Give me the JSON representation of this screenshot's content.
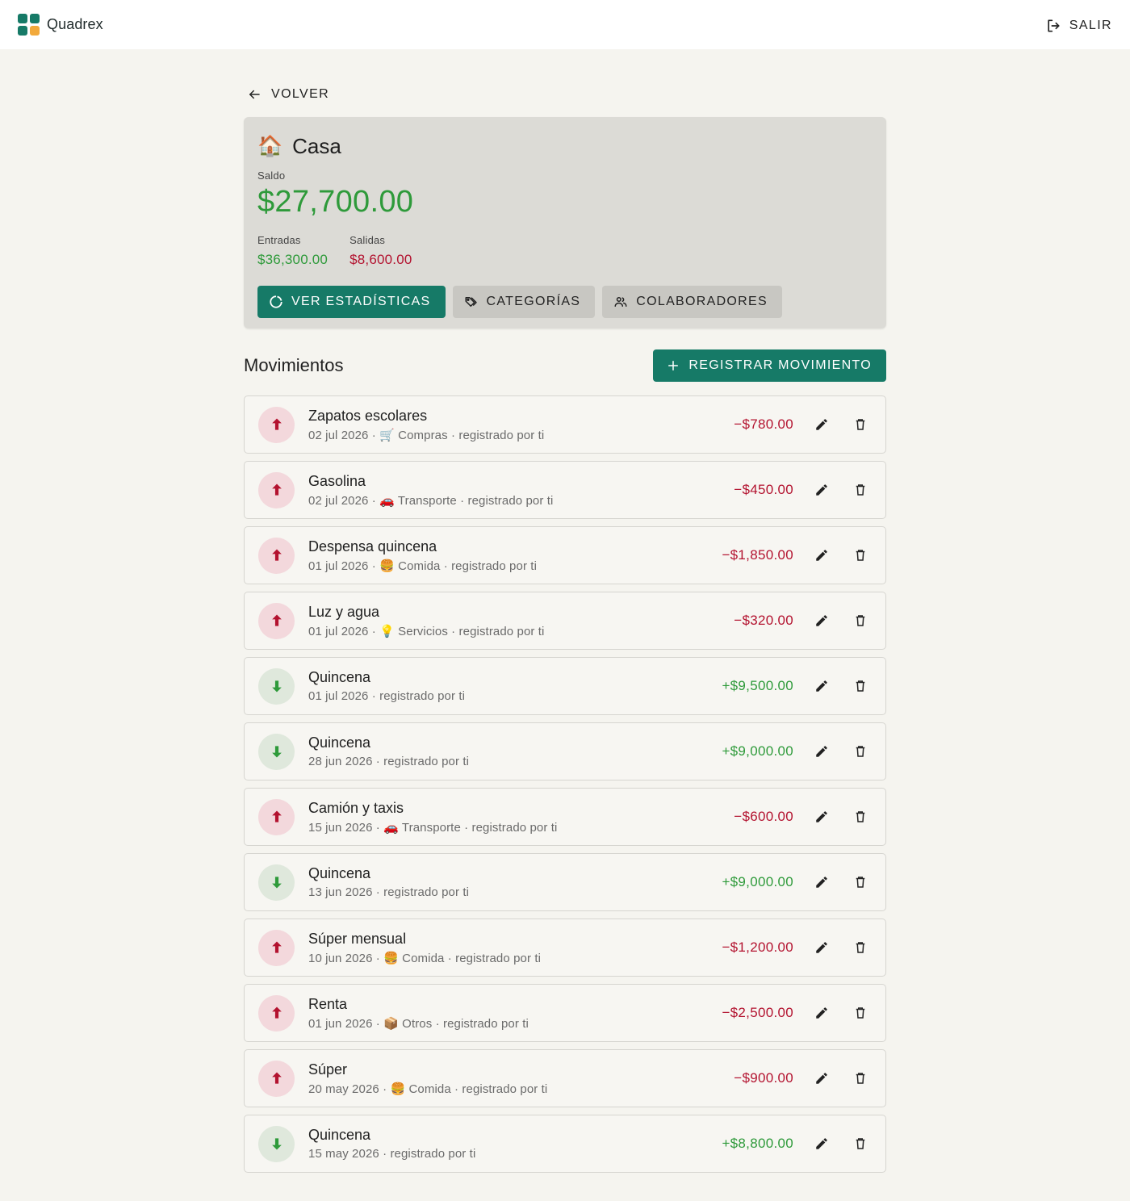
{
  "app": {
    "brand": "Quadrex",
    "logout_label": "SALIR",
    "logo_colors": [
      "#167a67",
      "#167a67",
      "#167a67",
      "#f2a93b"
    ]
  },
  "nav": {
    "back_label": "VOLVER"
  },
  "account": {
    "emoji": "🏠",
    "name": "Casa",
    "balance_label": "Saldo",
    "balance": "$27,700.00",
    "income_label": "Entradas",
    "income": "$36,300.00",
    "expense_label": "Salidas",
    "expense": "$8,600.00"
  },
  "actions": {
    "stats_label": "VER ESTADÍSTICAS",
    "categories_label": "CATEGORÍAS",
    "collaborators_label": "COLABORADORES"
  },
  "movements": {
    "title": "Movimientos",
    "register_label": "REGISTRAR MOVIMIENTO",
    "items": [
      {
        "type": "out",
        "description": "Zapatos escolares",
        "meta": "02 jul 2026 · 🛒 Compras · registrado por ti",
        "amount": "−$780.00"
      },
      {
        "type": "out",
        "description": "Gasolina",
        "meta": "02 jul 2026 · 🚗 Transporte · registrado por ti",
        "amount": "−$450.00"
      },
      {
        "type": "out",
        "description": "Despensa quincena",
        "meta": "01 jul 2026 · 🍔 Comida · registrado por ti",
        "amount": "−$1,850.00"
      },
      {
        "type": "out",
        "description": "Luz y agua",
        "meta": "01 jul 2026 · 💡 Servicios · registrado por ti",
        "amount": "−$320.00"
      },
      {
        "type": "in",
        "description": "Quincena",
        "meta": "01 jul 2026 · registrado por ti",
        "amount": "+$9,500.00"
      },
      {
        "type": "in",
        "description": "Quincena",
        "meta": "28 jun 2026 · registrado por ti",
        "amount": "+$9,000.00"
      },
      {
        "type": "out",
        "description": "Camión y taxis",
        "meta": "15 jun 2026 · 🚗 Transporte · registrado por ti",
        "amount": "−$600.00"
      },
      {
        "type": "in",
        "description": "Quincena",
        "meta": "13 jun 2026 · registrado por ti",
        "amount": "+$9,000.00"
      },
      {
        "type": "out",
        "description": "Súper mensual",
        "meta": "10 jun 2026 · 🍔 Comida · registrado por ti",
        "amount": "−$1,200.00"
      },
      {
        "type": "out",
        "description": "Renta",
        "meta": "01 jun 2026 · 📦 Otros · registrado por ti",
        "amount": "−$2,500.00"
      },
      {
        "type": "out",
        "description": "Súper",
        "meta": "20 may 2026 · 🍔 Comida · registrado por ti",
        "amount": "−$900.00"
      },
      {
        "type": "in",
        "description": "Quincena",
        "meta": "15 may 2026 · registrado por ti",
        "amount": "+$8,800.00"
      }
    ]
  },
  "colors": {
    "primary": "#167a67",
    "income": "#2e9a3a",
    "expense": "#b3122f"
  }
}
